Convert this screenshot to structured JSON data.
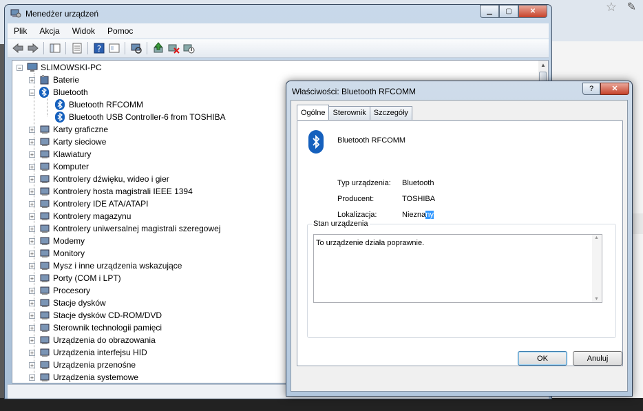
{
  "device_manager": {
    "title": "Menedżer urządzeń",
    "menu": [
      "Plik",
      "Akcja",
      "Widok",
      "Pomoc"
    ],
    "tree_root": "SLIMOWSKI-PC",
    "bluetooth_group": "Bluetooth",
    "bluetooth_children": [
      "Bluetooth RFCOMM",
      "Bluetooth USB Controller-6 from TOSHIBA"
    ],
    "categories_before": [
      "Baterie"
    ],
    "categories_after": [
      "Karty graficzne",
      "Karty sieciowe",
      "Klawiatury",
      "Komputer",
      "Kontrolery dźwięku, wideo i gier",
      "Kontrolery hosta magistrali IEEE 1394",
      "Kontrolery IDE ATA/ATAPI",
      "Kontrolery magazynu",
      "Kontrolery uniwersalnej magistrali szeregowej",
      "Modemy",
      "Monitory",
      "Mysz i inne urządzenia wskazujące",
      "Porty (COM i LPT)",
      "Procesory",
      "Stacje dysków",
      "Stacje dysków CD-ROM/DVD",
      "Sterownik technologii pamięci",
      "Urządzenia do obrazowania",
      "Urządzenia interfejsu HID",
      "Urządzenia przenośne",
      "Urządzenia systemowe"
    ]
  },
  "dialog": {
    "title": "Właściwości: Bluetooth RFCOMM",
    "help": "?",
    "close": "✕",
    "tabs": [
      "Ogólne",
      "Sterownik",
      "Szczegóły"
    ],
    "device_name": "Bluetooth RFCOMM",
    "props": {
      "type_label": "Typ urządzenia:",
      "type_value": "Bluetooth",
      "manufacturer_label": "Producent:",
      "manufacturer_value": "TOSHIBA",
      "location_label": "Lokalizacja:",
      "location_value_plain": "Niezna",
      "location_value_selected": "ny"
    },
    "status_group": "Stan urządzenia",
    "status_text": "To urządzenie działa poprawnie.",
    "ok": "OK",
    "cancel": "Anuluj"
  },
  "icons": {
    "bluetooth": "bluetooth-icon",
    "computer": "computer-icon",
    "back": "back-arrow-icon",
    "forward": "forward-arrow-icon"
  },
  "colors": {
    "bluetooth_blue": "#1560bd",
    "selection": "#3399ff",
    "close_red": "#c7422a"
  }
}
